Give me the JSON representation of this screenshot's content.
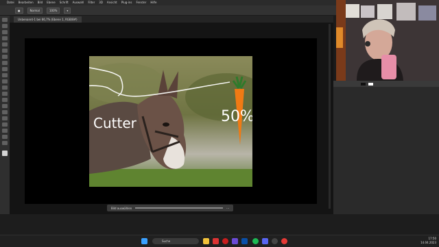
{
  "menubar": {
    "items": [
      "Datei",
      "Bearbeiten",
      "Bild",
      "Ebene",
      "Schrift",
      "Auswahl",
      "Filter",
      "3D",
      "Ansicht",
      "Plug-ins",
      "Fenster",
      "Hilfe"
    ]
  },
  "options": {
    "mode": "Normal",
    "opacity": "100%"
  },
  "document": {
    "tab_title": "Unbenannt-1 bei 66,7% (Ebene 1, RGB/8#)"
  },
  "annotations": {
    "label_left": "Cutter",
    "label_right": "50%"
  },
  "context_bar": {
    "label": "Bild auswählen"
  },
  "taskbar": {
    "search_placeholder": "Suche",
    "time": "17:50",
    "date": "14.04.2023"
  },
  "colors": {
    "accent": "#ff7a00",
    "photoshop_bg": "#1b1b1b",
    "canvas": "#000000"
  }
}
